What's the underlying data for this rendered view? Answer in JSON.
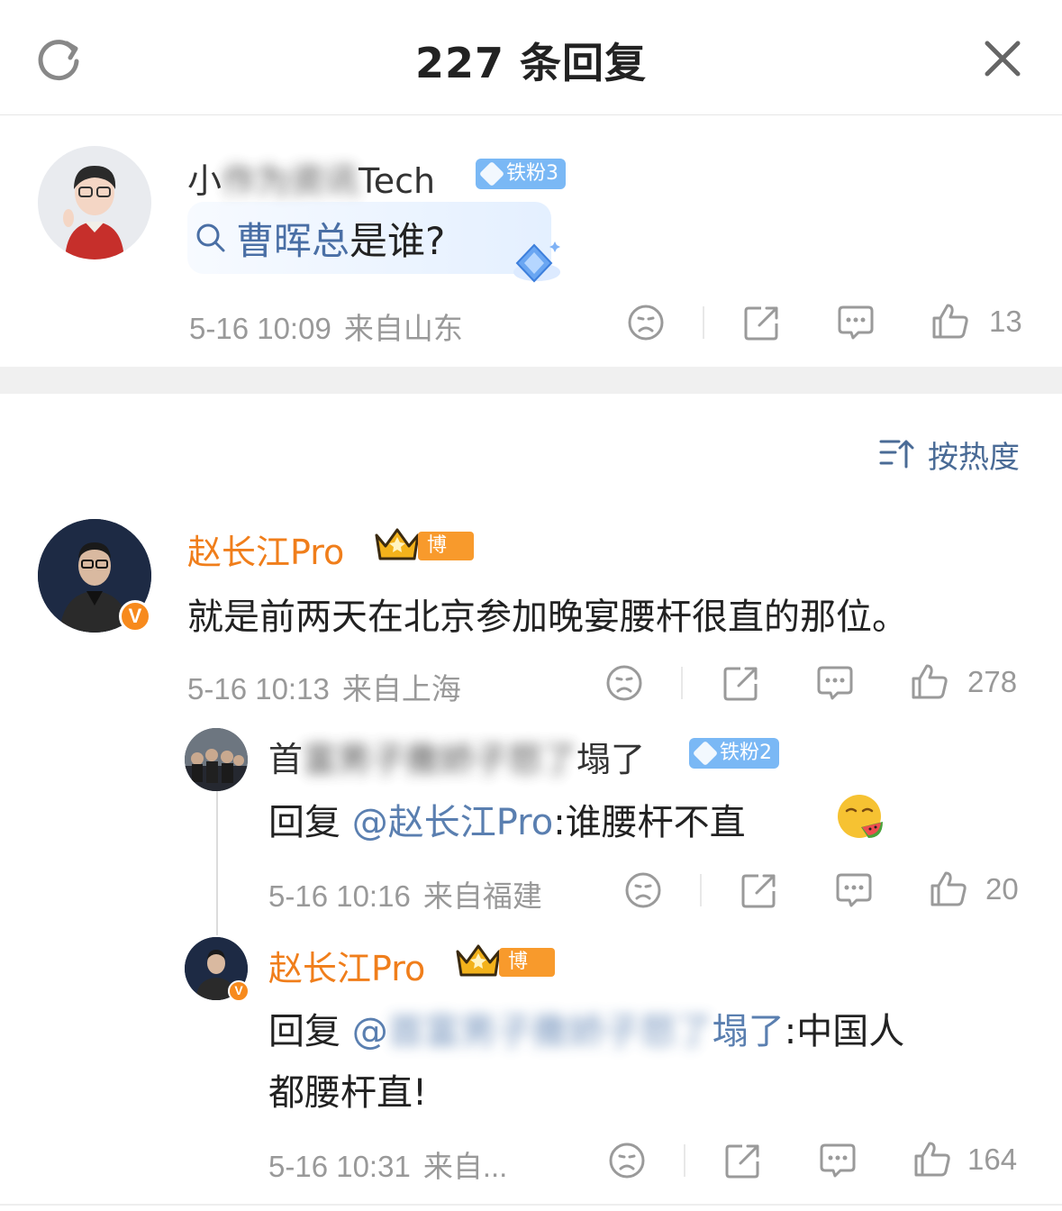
{
  "header": {
    "title": "227 条回复",
    "refresh_icon": "refresh-icon",
    "close_icon": "close-icon"
  },
  "root": {
    "name": "小",
    "name_obscured": "作为资讯",
    "name_suffix": "Tech",
    "badge": "铁粉3",
    "search_prefix": "曹晖总",
    "search_suffix": "是谁?",
    "time": "5-16 10:09",
    "location": "来自山东",
    "likes": "13"
  },
  "sort": {
    "label": "按热度"
  },
  "comments": [
    {
      "name": "赵长江Pro",
      "badge": "博主",
      "text": "就是前两天在北京参加晚宴腰杆很直的那位。",
      "time": "5-16 10:13",
      "location": "来自上海",
      "likes": "278"
    },
    {
      "name_start": "首",
      "name_obscured": "富男子撒娇子怒了",
      "name_end": "塌了",
      "badge": "铁粉2",
      "reply_prefix": "回复",
      "reply_to": "@赵长江Pro",
      "reply_text": ":谁腰杆不直",
      "time": "5-16 10:16",
      "location": "来自福建",
      "likes": "20"
    },
    {
      "name": "赵长江Pro",
      "badge": "博主",
      "reply_prefix": "回复",
      "reply_to_start": "@",
      "reply_to_obscured": "首富男子撒娇子怒了",
      "reply_to_end": "塌了",
      "reply_text_line1": ":中国人",
      "reply_text_line2": "都腰杆直!",
      "time": "5-16 10:31",
      "location": "来自...",
      "likes": "164"
    }
  ],
  "colors": {
    "orange": "#f07e1b",
    "link": "#5a7fb0",
    "meta": "#999999",
    "fan_badge": "#7ab8f5",
    "bozhu_badge": "#f89a2c"
  }
}
